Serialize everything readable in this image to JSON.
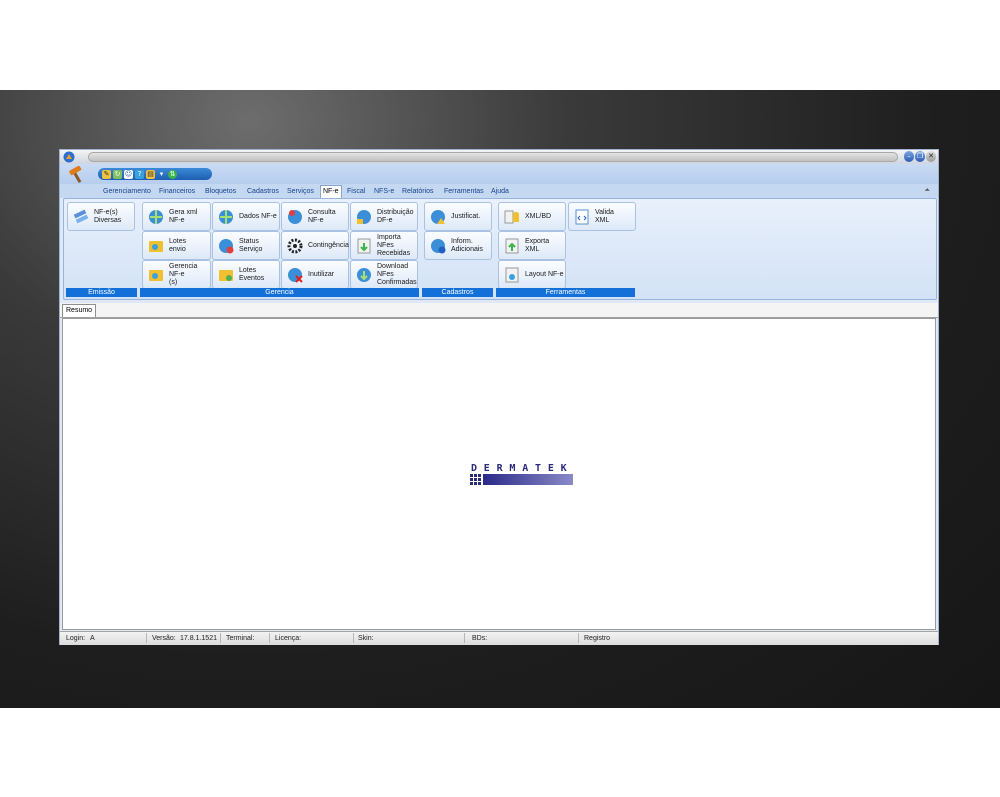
{
  "menu": {
    "tabs": [
      "Gerenciamento",
      "Financeiros",
      "Bloquetos",
      "Cadastros",
      "Serviços",
      "NF-e",
      "Fiscal",
      "NFS-e",
      "Relatórios",
      "Ferramentas",
      "Ajuda"
    ],
    "active_tab": "NF-e"
  },
  "ribbon": {
    "groups": {
      "emissao": "Emissão",
      "gerencia": "Gerencia",
      "cadastros": "Cadastros",
      "ferramentas": "Ferramentas"
    },
    "buttons": {
      "nfe_diversas": "NF-e(s)\nDiversas",
      "gera_xml": "Gera xml\nNF-e",
      "lotes_envio": "Lotes\nenvio",
      "gerencia_nfe": "Gerencia NF-e\n(s)",
      "dados_nfe": "Dados NF-e",
      "status_servico": "Status Serviço",
      "lotes_eventos": "Lotes\nEventos",
      "consulta_nfe": "Consulta NF-e",
      "contingencia": "Contingência",
      "inutilizar": "Inutilizar",
      "distribuicao": "Distribuição\nDF-e",
      "importa_nfes": "Importa NFes\nRecebidas",
      "download_nfes": "Download\nNFes\nConfirmadas",
      "justificat": "Justificat.",
      "inform_adicionais": "Inform.\nAdicionais",
      "xml_bd": "XML/BD",
      "exporta_xml": "Exporta XML",
      "layout_nfe": "Layout NF-e",
      "valida_xml": "Valida\nXML"
    }
  },
  "document_tab": "Resumo",
  "logo_text": "DERMATEK",
  "status": {
    "login_label": "Login:",
    "login_value": "A",
    "versao_label": "Versão:",
    "versao_value": "17.8.1.1521",
    "terminal_label": "Terminal:",
    "licenca_label": "Licença:",
    "skin_label": "Skin:",
    "bds_label": "BDs:",
    "registro_label": "Registro"
  },
  "colors": {
    "accent": "#1270d8",
    "ribbon_bg": "#dfe8f6",
    "tab_text": "#15428b"
  }
}
